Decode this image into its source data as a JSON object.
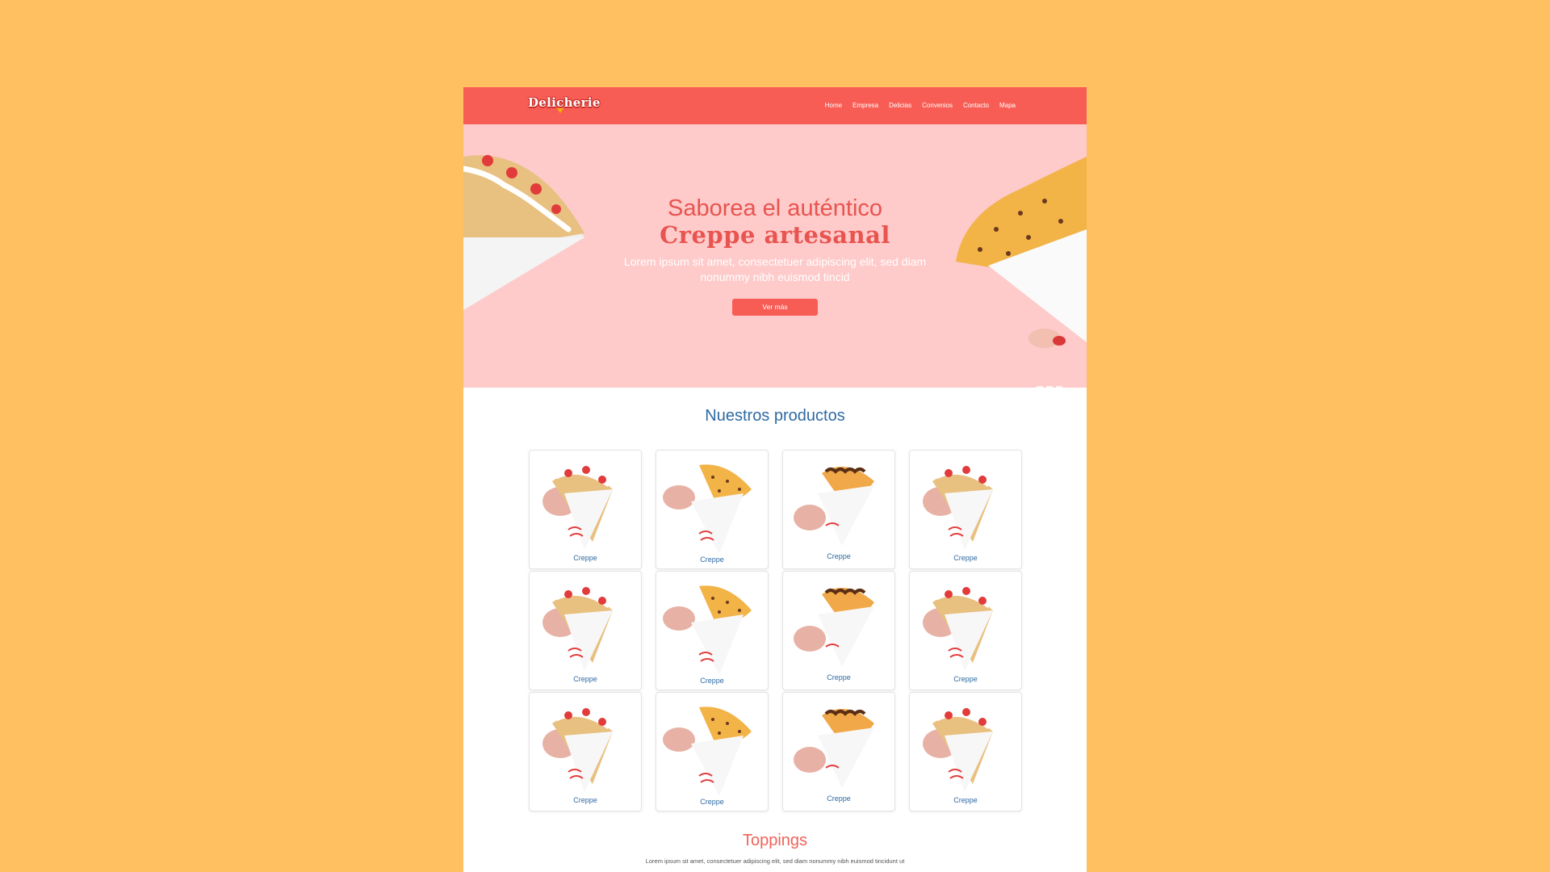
{
  "brand": {
    "logo_text": "Delicherie",
    "accent": "#F85D55",
    "hero_bg": "#FECACA",
    "page_bg": "#FFC061",
    "title_blue": "#2E6AA3"
  },
  "nav": {
    "items": [
      {
        "label": "Home"
      },
      {
        "label": "Empresa"
      },
      {
        "label": "Delicias"
      },
      {
        "label": "Convenios"
      },
      {
        "label": "Contacto"
      },
      {
        "label": "Mapa"
      }
    ]
  },
  "hero": {
    "title_line1": "Saborea el auténtico",
    "title_line2": "Creppe artesanal",
    "text": "Lorem ipsum sit amet, consectetuer adipiscing elit, sed diam nonummy nibh euismod tincid",
    "button_label": "Ver más"
  },
  "products": {
    "title": "Nuestros productos",
    "items": [
      {
        "label": "Creppe",
        "variant": "strawberry"
      },
      {
        "label": "Creppe",
        "variant": "chocochip"
      },
      {
        "label": "Creppe",
        "variant": "chocolate"
      },
      {
        "label": "Creppe",
        "variant": "strawberry"
      },
      {
        "label": "Creppe",
        "variant": "strawberry"
      },
      {
        "label": "Creppe",
        "variant": "chocochip"
      },
      {
        "label": "Creppe",
        "variant": "chocolate"
      },
      {
        "label": "Creppe",
        "variant": "strawberry"
      },
      {
        "label": "Creppe",
        "variant": "strawberry"
      },
      {
        "label": "Creppe",
        "variant": "chocochip"
      },
      {
        "label": "Creppe",
        "variant": "chocolate"
      },
      {
        "label": "Creppe",
        "variant": "strawberry"
      }
    ]
  },
  "toppings": {
    "title": "Toppings",
    "text": "Lorem ipsum sit amet, consectetuer adipiscing elit, sed diam nonummy nibh euismod tincidunt ut"
  }
}
